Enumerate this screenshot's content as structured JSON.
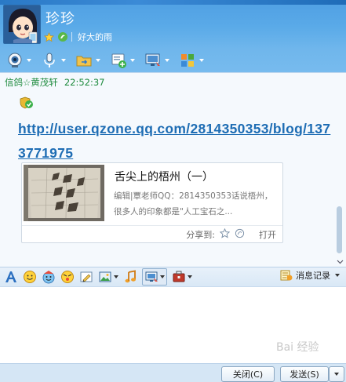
{
  "contact": {
    "name": "珍珍",
    "signature": "好大的雨"
  },
  "toolbar": {
    "items": [
      "video-call",
      "voice-call",
      "file-transfer",
      "app-store",
      "remote-assist",
      "more-apps"
    ]
  },
  "message": {
    "sender": "信鸽☆黄茂轩",
    "time": "22:52:37",
    "link": "http://user.qzone.qq.com/2814350353/blog/1373771975"
  },
  "card": {
    "title": "舌尖上的梧州（一）",
    "description": "编辑|覃老师QQ：2814350353话说梧州，很多人的印象都是\"人工宝石之...",
    "share_label": "分享到:",
    "open_label": "打开"
  },
  "format_bar": {
    "history_label": "消息记录"
  },
  "buttons": {
    "close": "关闭(C)",
    "send": "发送(S)"
  },
  "watermark": "Bai 经验",
  "colors": {
    "header_blue": "#5aaae8",
    "link": "#1e6db4",
    "sender_green": "#1c8a3c"
  }
}
